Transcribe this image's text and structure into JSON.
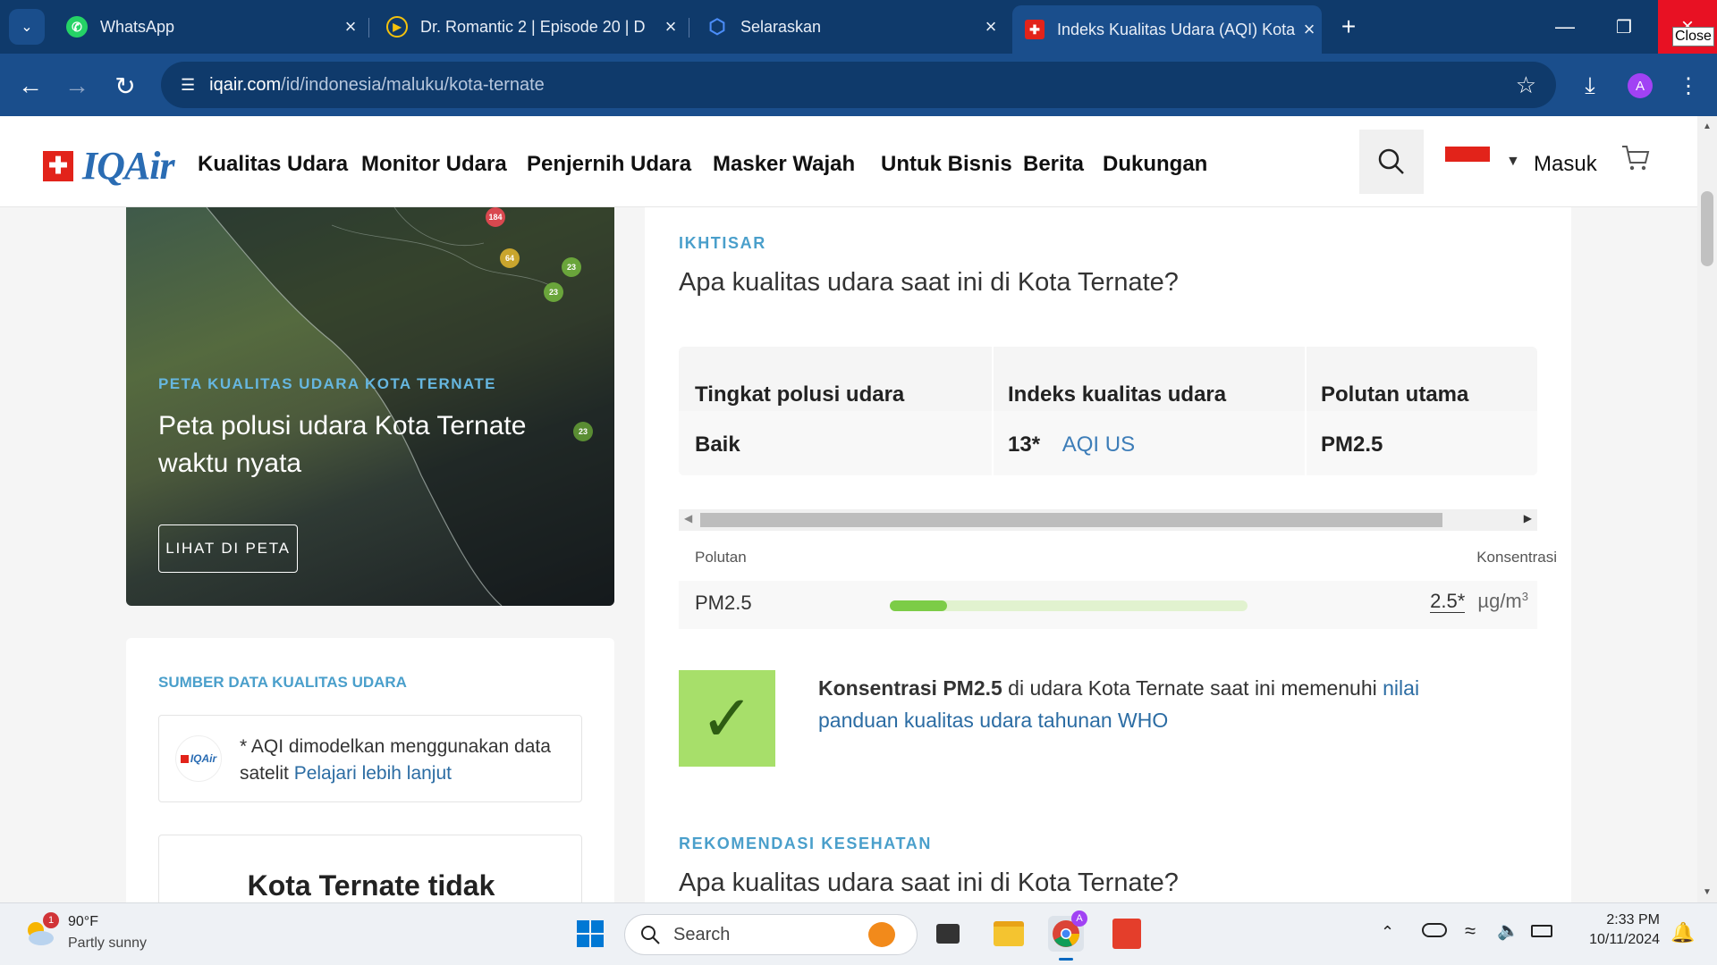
{
  "browser": {
    "tabs": [
      {
        "label": "WhatsApp",
        "icon": "whatsapp-icon",
        "active": false
      },
      {
        "label": "Dr. Romantic 2 | Episode 20 | D",
        "icon": "play-icon",
        "active": false
      },
      {
        "label": "Selaraskan",
        "icon": "hexagon-icon",
        "active": false
      },
      {
        "label": "Indeks Kualitas Udara (AQI) Kota",
        "icon": "iqair-cross-icon",
        "active": true
      }
    ],
    "close_tooltip": "Close",
    "url_host": "iqair.com",
    "url_path": "/id/indonesia/maluku/kota-ternate",
    "profile_initial": "A"
  },
  "site": {
    "logo_text": "IQAir",
    "nav": [
      "Kualitas Udara",
      "Monitor Udara",
      "Penjernih Udara",
      "Masker Wajah",
      "Untuk Bisnis",
      "Berita",
      "Dukungan"
    ],
    "login": "Masuk"
  },
  "map_card": {
    "tag": "PETA KUALITAS UDARA KOTA TERNATE",
    "title_line1": "Peta polusi udara Kota Ternate",
    "title_line2": "waktu nyata",
    "button": "LIHAT DI PETA",
    "dots": [
      {
        "value": "184",
        "color": "#d9484f"
      },
      {
        "value": "64",
        "color": "#d5b030"
      },
      {
        "value": "23",
        "color": "#6aa53b"
      },
      {
        "value": "23",
        "color": "#6aa53b"
      },
      {
        "value": "23",
        "color": "#5a8d33"
      }
    ]
  },
  "source_card": {
    "tag": "SUMBER DATA KUALITAS UDARA",
    "logo_text": "IQAir",
    "note": "* AQI dimodelkan menggunakan data",
    "note2": "satelit",
    "link": "Pelajari lebih lanjut",
    "next_title": "Kota Ternate tidak"
  },
  "overview": {
    "tag": "IKHTISAR",
    "question": "Apa kualitas udara saat ini di Kota Ternate?",
    "table": {
      "headers": [
        "Tingkat polusi udara",
        "Indeks kualitas udara",
        "Polutan utama"
      ],
      "level": "Baik",
      "aqi_value": "13*",
      "aqi_unit": "AQI US",
      "pollutant": "PM2.5"
    },
    "pollutant_header": "Polutan",
    "concentration_header": "Konsentrasi",
    "pm_row": {
      "name": "PM2.5",
      "value": "2.5*",
      "unit": "µg/m",
      "unit_sup": "3",
      "fill": 0.16
    },
    "who": {
      "bold": "Konsentrasi PM2.5",
      "text": " di udara Kota Ternate saat ini memenuhi ",
      "link1": "nilai",
      "link2": "panduan kualitas udara tahunan WHO"
    },
    "rec_tag": "REKOMENDASI KESEHATAN",
    "rec_question": "Apa kualitas udara saat ini di Kota Ternate?"
  },
  "taskbar": {
    "weather_temp": "90°F",
    "weather_desc": "Partly sunny",
    "weather_badge": "1",
    "search": "Search",
    "chrome_badge": "A",
    "time": "2:33 PM",
    "date": "10/11/2024"
  },
  "colors": {
    "chrome_dark": "#0f3a6b",
    "chrome": "#1a4e8c",
    "accent": "#4a9fcb",
    "good": "#a7df6a",
    "link": "#2b6ca3"
  }
}
